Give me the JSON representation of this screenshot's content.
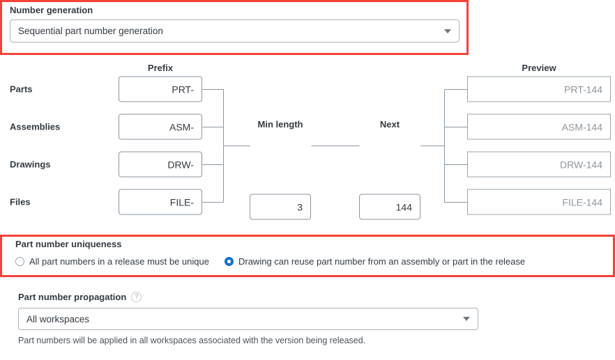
{
  "number_generation": {
    "label": "Number generation",
    "selected": "Sequential part number generation",
    "options": [
      "Sequential part number generation"
    ]
  },
  "diagram": {
    "prefix_header": "Prefix",
    "preview_header": "Preview",
    "min_length_header": "Min length",
    "next_header": "Next",
    "min_length_value": "3",
    "next_value": "144",
    "rows": [
      {
        "label": "Parts",
        "prefix": "PRT-",
        "preview": "PRT-144"
      },
      {
        "label": "Assemblies",
        "prefix": "ASM-",
        "preview": "ASM-144"
      },
      {
        "label": "Drawings",
        "prefix": "DRW-",
        "preview": "DRW-144"
      },
      {
        "label": "Files",
        "prefix": "FILE-",
        "preview": "FILE-144"
      }
    ]
  },
  "uniqueness": {
    "label": "Part number uniqueness",
    "options": [
      {
        "label": "All part numbers in a release must be unique",
        "selected": false
      },
      {
        "label": "Drawing can reuse part number from an assembly or part in the release",
        "selected": true
      }
    ]
  },
  "propagation": {
    "label": "Part number propagation",
    "help_icon": "?",
    "selected": "All workspaces",
    "options": [
      "All workspaces"
    ],
    "hint": "Part numbers will be applied in all workspaces associated with the version being released."
  },
  "colors": {
    "highlight": "#f4433a",
    "radio_selected": "#1070d3",
    "border": "#8a96a0",
    "text": "#333b43",
    "muted_text": "#8d969e"
  }
}
